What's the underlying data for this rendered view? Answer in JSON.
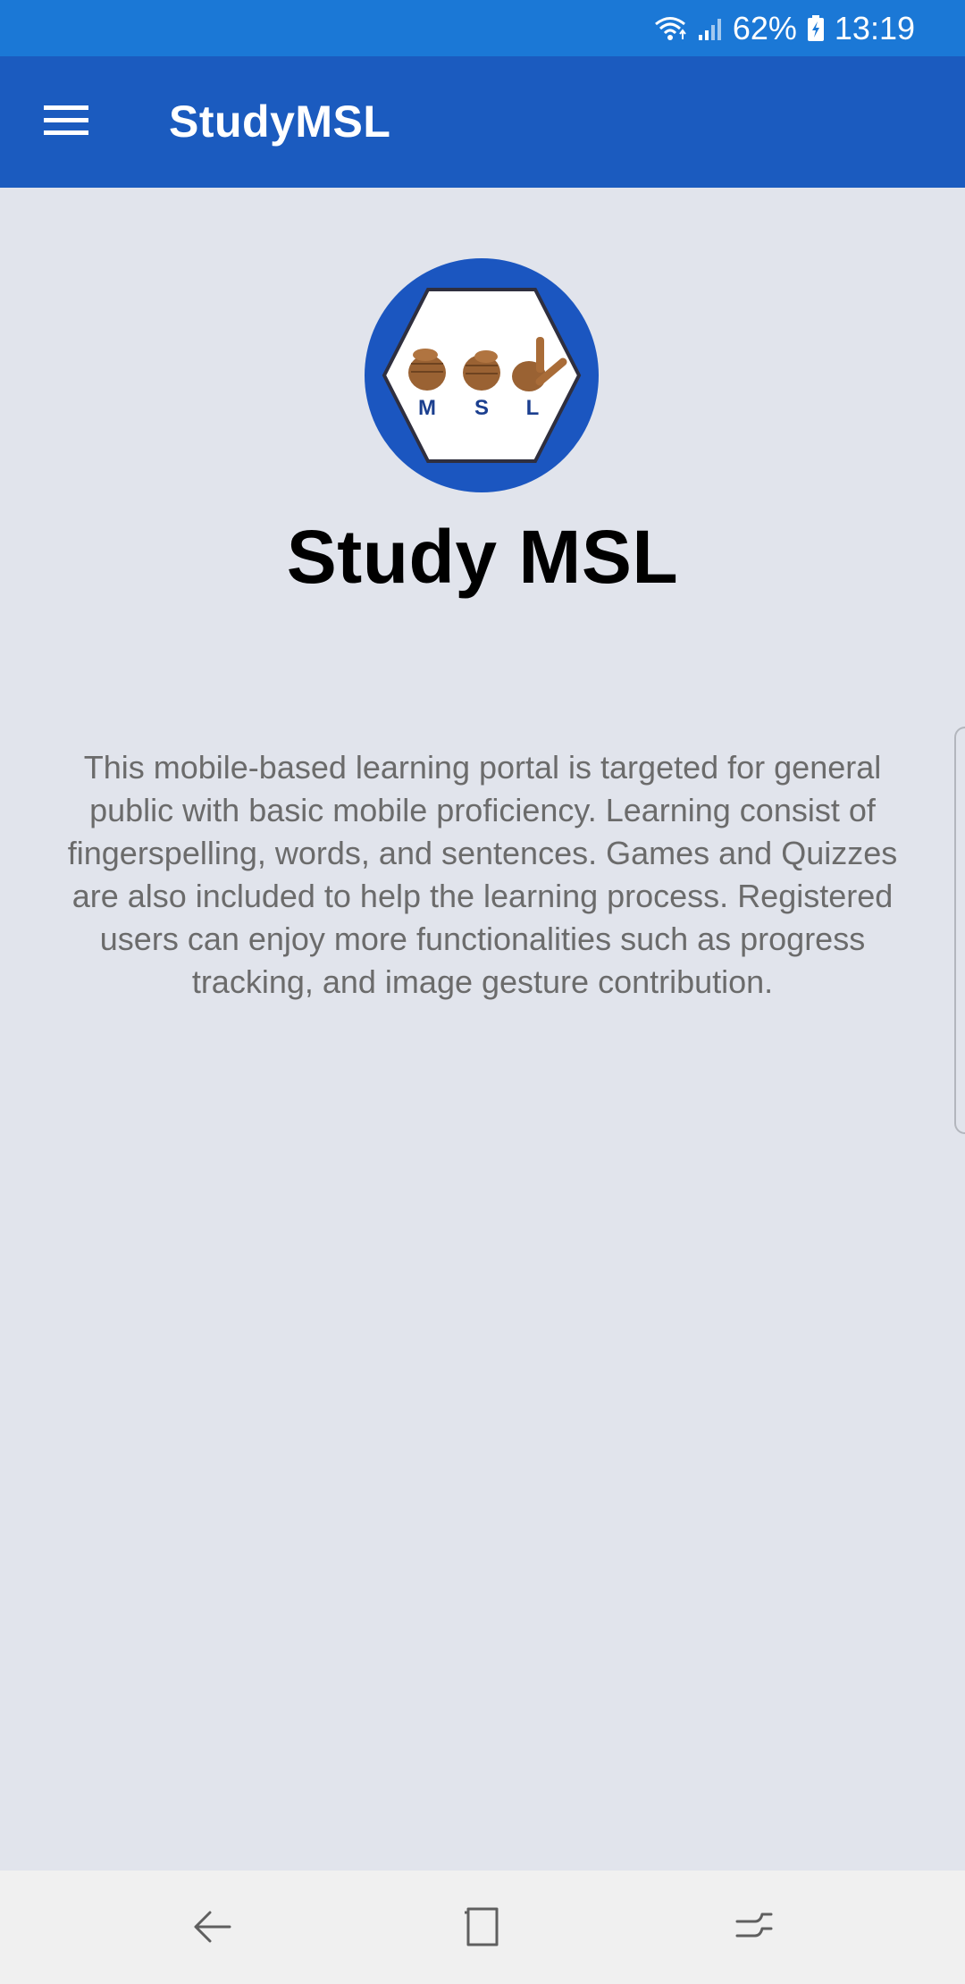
{
  "status_bar": {
    "battery": "62%",
    "time": "13:19"
  },
  "app_bar": {
    "title": "StudyMSL",
    "menu_icon": "hamburger-menu-icon"
  },
  "main": {
    "logo": {
      "letters": [
        "M",
        "S",
        "L"
      ],
      "ring_color": "#1b56c0"
    },
    "headline": "Study MSL",
    "description": "This mobile-based learning portal is targeted for general public with basic mobile proficiency. Learning consist of fingerspelling, words, and sentences. Games and Quizzes are also included to help the learning process. Registered users can enjoy more functionalities such as progress tracking, and image gesture contribution."
  },
  "nav_bar": {
    "icons": [
      "back-icon",
      "home-icon",
      "recents-icon"
    ]
  },
  "colors": {
    "status_bar": "#1b78d6",
    "app_bar": "#1b5bbf",
    "background": "#e1e4ec",
    "nav_bar": "#f0f0f0"
  }
}
